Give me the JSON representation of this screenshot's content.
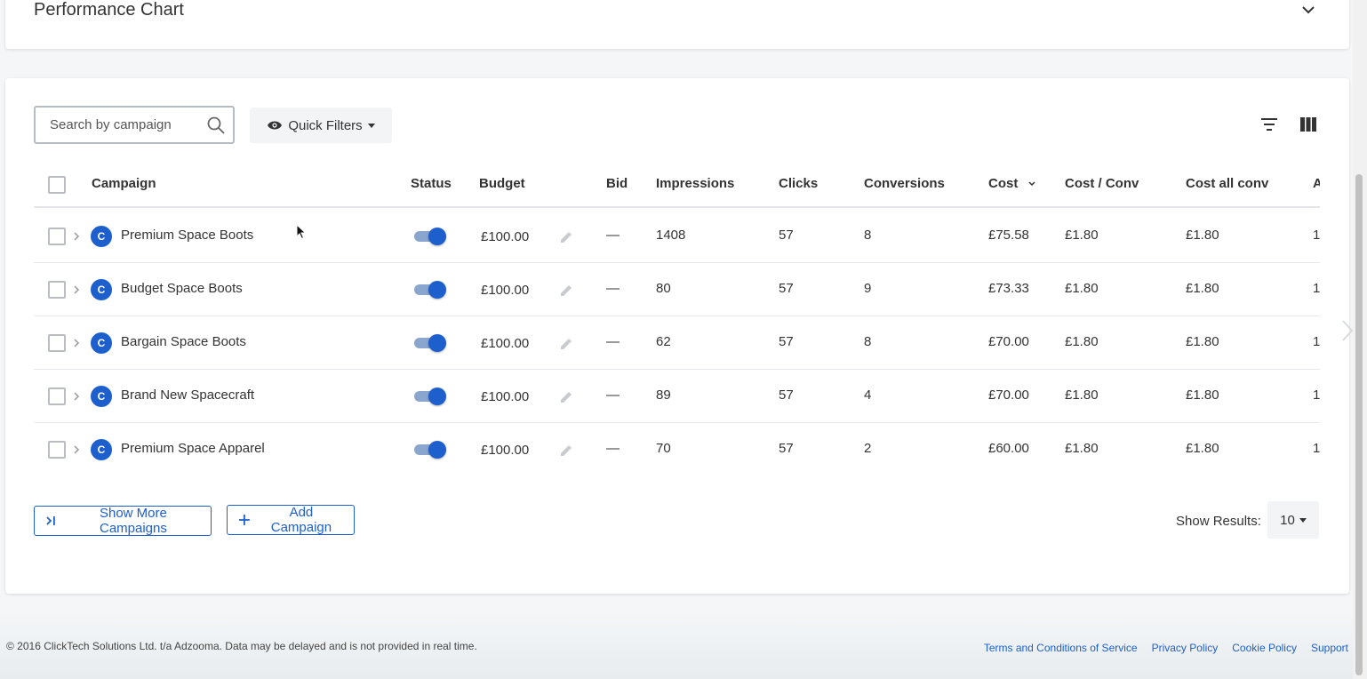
{
  "performance_chart": {
    "title": "Performance Chart"
  },
  "toolbar": {
    "search_placeholder": "Search by campaign",
    "quick_filters_label": "Quick Filters"
  },
  "table": {
    "headers": {
      "campaign": "Campaign",
      "status": "Status",
      "budget": "Budget",
      "bid": "Bid",
      "impressions": "Impressions",
      "clicks": "Clicks",
      "conversions": "Conversions",
      "cost": "Cost",
      "cost_conv": "Cost / Conv",
      "cost_all_conv": "Cost all conv",
      "next": "A"
    },
    "rows": [
      {
        "badge": "C",
        "name": "Premium Space Boots",
        "status": "on",
        "budget": "£100.00",
        "bid": "—",
        "impressions": "1408",
        "clicks": "57",
        "conversions": "8",
        "cost": "£75.58",
        "cost_conv": "£1.80",
        "cost_all_conv": "£1.80",
        "next": "1."
      },
      {
        "badge": "C",
        "name": "Budget Space Boots",
        "status": "on",
        "budget": "£100.00",
        "bid": "—",
        "impressions": "80",
        "clicks": "57",
        "conversions": "9",
        "cost": "£73.33",
        "cost_conv": "£1.80",
        "cost_all_conv": "£1.80",
        "next": "1."
      },
      {
        "badge": "C",
        "name": "Bargain Space Boots",
        "status": "on",
        "budget": "£100.00",
        "bid": "—",
        "impressions": "62",
        "clicks": "57",
        "conversions": "8",
        "cost": "£70.00",
        "cost_conv": "£1.80",
        "cost_all_conv": "£1.80",
        "next": "1."
      },
      {
        "badge": "C",
        "name": "Brand New Spacecraft",
        "status": "on",
        "budget": "£100.00",
        "bid": "—",
        "impressions": "89",
        "clicks": "57",
        "conversions": "4",
        "cost": "£70.00",
        "cost_conv": "£1.80",
        "cost_all_conv": "£1.80",
        "next": "1."
      },
      {
        "badge": "C",
        "name": "Premium Space Apparel",
        "status": "on",
        "budget": "£100.00",
        "bid": "—",
        "impressions": "70",
        "clicks": "57",
        "conversions": "2",
        "cost": "£60.00",
        "cost_conv": "£1.80",
        "cost_all_conv": "£1.80",
        "next": "1."
      }
    ]
  },
  "actions": {
    "show_more_label": "Show More Campaigns",
    "add_campaign_label": "Add Campaign",
    "show_results_label": "Show Results:",
    "results_value": "10"
  },
  "footer": {
    "copyright": "© 2016 ClickTech Solutions Ltd. t/a Adzooma. Data may be delayed and is not provided in real time.",
    "links": [
      "Terms and Conditions of Service",
      "Privacy Policy",
      "Cookie Policy",
      "Support"
    ]
  },
  "colors": {
    "accent": "#1d5fcc",
    "text": "#333333",
    "background": "#f4f6f8"
  }
}
